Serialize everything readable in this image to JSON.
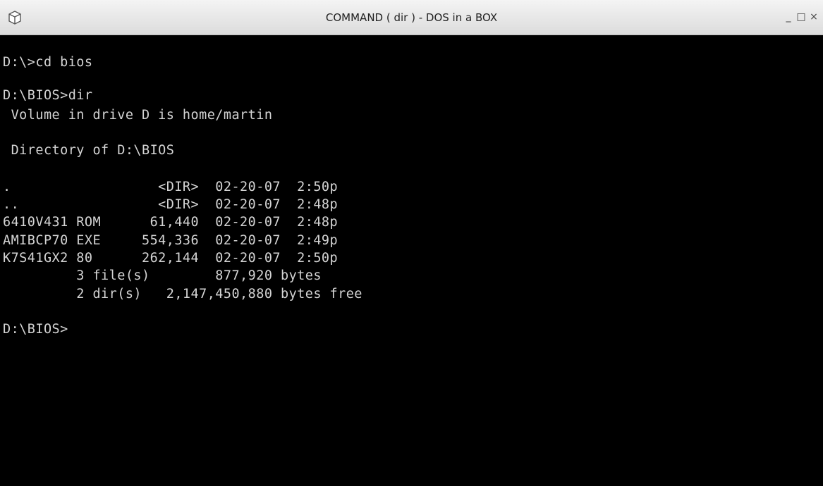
{
  "window": {
    "title": "COMMAND ( dir ) - DOS in a BOX",
    "controls": {
      "minimize": "_",
      "maximize": "□",
      "close": "×"
    },
    "icon": "cube-icon"
  },
  "console": {
    "lines": [
      "D:\\>cd bios",
      "D:\\BIOS>dir",
      " Volume in drive D is home/martin",
      " Directory of D:\\BIOS",
      ".                  <DIR>  02-20-07  2:50p",
      "..                 <DIR>  02-20-07  2:48p",
      "6410V431 ROM      61,440  02-20-07  2:48p",
      "AMIBCP70 EXE     554,336  02-20-07  2:49p",
      "K7S41GX2 80      262,144  02-20-07  2:50p",
      "         3 file(s)        877,920 bytes",
      "         2 dir(s)   2,147,450,880 bytes free",
      "D:\\BIOS>"
    ]
  }
}
